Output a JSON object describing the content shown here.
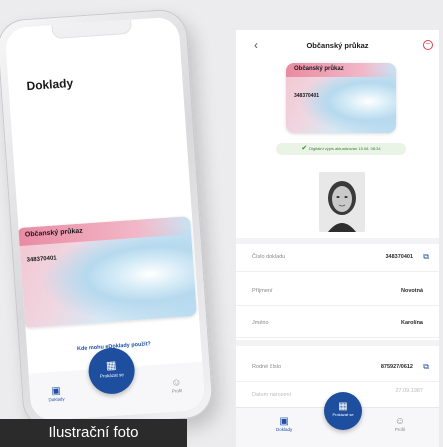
{
  "left_phone": {
    "title": "Doklady",
    "card": {
      "title": "Občanský průkaz",
      "number": "348370401"
    },
    "help_link": "Kde mohu eDoklady použít?",
    "tabs": [
      {
        "label": "Doklady",
        "icon": "id-card-icon"
      },
      {
        "label": "Prokázat se",
        "icon": "wallet-icon"
      },
      {
        "label": "Profil",
        "icon": "person-icon"
      }
    ]
  },
  "right_phone": {
    "title": "Občanský průkaz",
    "card": {
      "title": "Občanský průkaz",
      "number": "348370401"
    },
    "status": "Digitální výpis aktualizován 15.08. 08:34",
    "fields": [
      {
        "label": "Číslo dokladu",
        "value": "348370401",
        "copyable": true
      },
      {
        "label": "Příjmení",
        "value": "Novotná",
        "copyable": false
      },
      {
        "label": "Jméno",
        "value": "Karolína",
        "copyable": false
      },
      {
        "label": "Rodné číslo",
        "value": "875927/0612",
        "copyable": true
      },
      {
        "label": "Datum narození",
        "value": "27.09.1987",
        "copyable": false
      }
    ],
    "tabs": [
      {
        "label": "Doklady",
        "icon": "id-card-icon"
      },
      {
        "label": "Prokázat se",
        "icon": "wallet-icon"
      },
      {
        "label": "Profil",
        "icon": "person-icon"
      }
    ]
  },
  "caption": "Ilustrační foto",
  "colors": {
    "accent": "#1d4f9e",
    "status_green": "#3c8c2e",
    "close_red": "#d9434e"
  }
}
